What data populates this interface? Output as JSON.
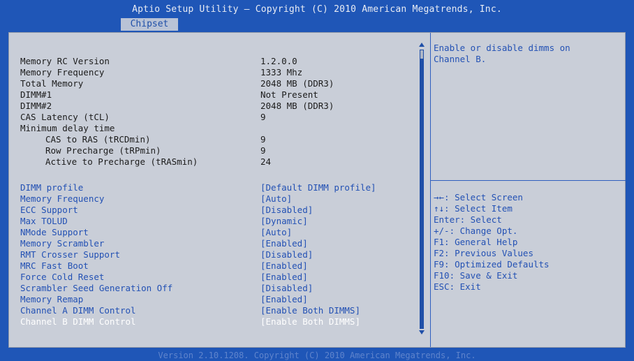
{
  "header": {
    "title": "Aptio Setup Utility – Copyright (C) 2010 American Megatrends, Inc.",
    "active_tab": "Chipset"
  },
  "info_rows": [
    {
      "label": "Memory RC Version",
      "value": "1.2.0.0"
    },
    {
      "label": "Memory Frequency",
      "value": "1333 Mhz"
    },
    {
      "label": "Total Memory",
      "value": "2048 MB (DDR3)"
    },
    {
      "label": "DIMM#1",
      "value": "Not Present"
    },
    {
      "label": "DIMM#2",
      "value": "2048 MB (DDR3)"
    },
    {
      "label": "CAS Latency (tCL)",
      "value": "9"
    },
    {
      "label": "Minimum delay time",
      "value": ""
    },
    {
      "label": "CAS to RAS (tRCDmin)",
      "value": "9"
    },
    {
      "label": "Row Precharge (tRPmin)",
      "value": "9"
    },
    {
      "label": "Active to Precharge (tRASmin)",
      "value": "24"
    }
  ],
  "settings_rows": [
    {
      "label": "DIMM profile",
      "value": "[Default DIMM profile]"
    },
    {
      "label": "Memory Frequency",
      "value": "[Auto]"
    },
    {
      "label": "ECC Support",
      "value": "[Disabled]"
    },
    {
      "label": "Max TOLUD",
      "value": "[Dynamic]"
    },
    {
      "label": "NMode Support",
      "value": "[Auto]"
    },
    {
      "label": "Memory Scrambler",
      "value": "[Enabled]"
    },
    {
      "label": "RMT Crosser Support",
      "value": "[Disabled]"
    },
    {
      "label": "MRC Fast Boot",
      "value": "[Enabled]"
    },
    {
      "label": "Force Cold Reset",
      "value": "[Enabled]"
    },
    {
      "label": "Scrambler Seed Generation Off",
      "value": "[Disabled]"
    },
    {
      "label": "Memory Remap",
      "value": "[Enabled]"
    },
    {
      "label": "Channel A DIMM Control",
      "value": "[Enable Both DIMMS]"
    },
    {
      "label": "Channel B DIMM Control",
      "value": "[Enable Both DIMMS]"
    }
  ],
  "selected_setting": "Channel B DIMM Control",
  "help": {
    "description": "Enable or disable dimms on\nChannel B."
  },
  "keys": [
    "→←: Select Screen",
    "↑↓: Select Item",
    "Enter: Select",
    "+/-: Change Opt.",
    "F1: General Help",
    "F2: Previous Values",
    "F9: Optimized Defaults",
    "F10: Save & Exit",
    "ESC: Exit"
  ],
  "footer": {
    "text": "Version 2.10.1208. Copyright (C) 2010 American Megatrends, Inc."
  },
  "colors": {
    "background": "#1f56b7",
    "panel": "#c9ced8",
    "link_text": "#2351b4",
    "selected_text": "#ffffff"
  }
}
